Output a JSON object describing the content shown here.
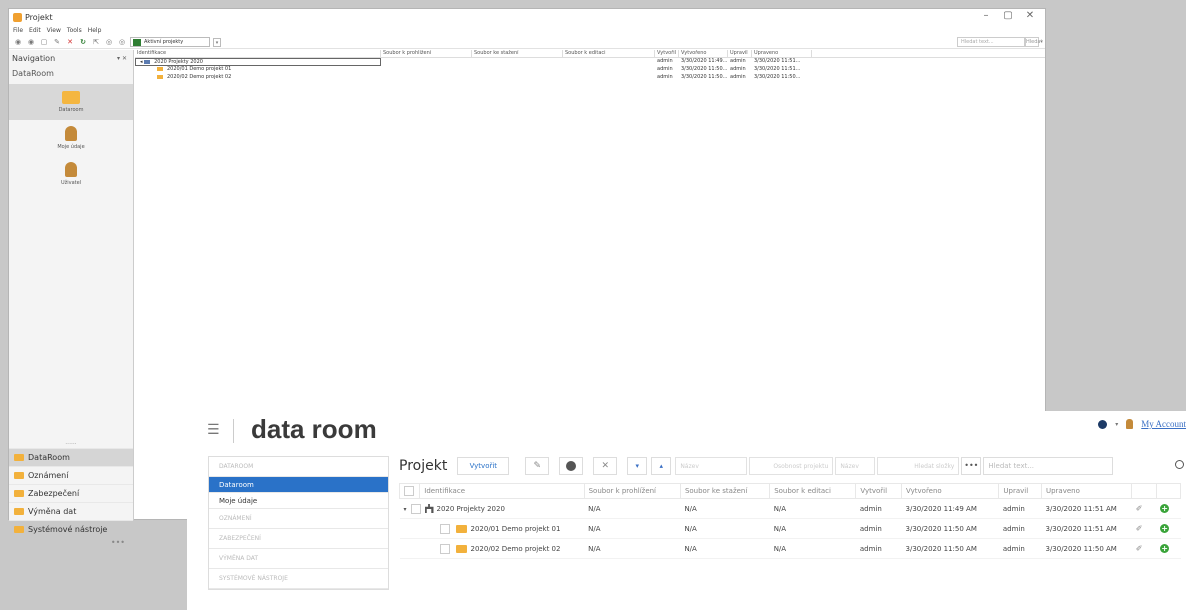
{
  "desktop": {
    "title": "Projekt",
    "window_controls": [
      "–",
      "▢",
      "✕"
    ],
    "menu": [
      "File",
      "Edit",
      "View",
      "Tools",
      "Help"
    ],
    "toolbar": {
      "filter_combo": "Aktivní projekty",
      "search_placeholder": "Hledat text...",
      "search_button": "Hledat"
    },
    "nav": {
      "header": "Navigation",
      "pin": "▾ ✕",
      "section": "DataRoom",
      "tiles": [
        "Dataroom",
        "Moje údaje",
        "Uživatel"
      ],
      "dots": "......",
      "bottom_items": [
        "DataRoom",
        "Oznámení",
        "Zabezpečení",
        "Výměna dat",
        "Systémové nástroje"
      ],
      "more": "•••"
    },
    "grid": {
      "columns": [
        "Identifikace",
        "Soubor k prohlížení",
        "Soubor ke stažení",
        "Soubor k editaci",
        "Vytvořil",
        "Vytvořeno",
        "Upravil",
        "Upraveno"
      ],
      "rows": [
        {
          "name": "2020 Projekty 2020",
          "created_by": "admin",
          "created": "3/30/2020 11:49...",
          "modified_by": "admin",
          "modified": "3/30/2020 11:51..."
        },
        {
          "name": "2020/01 Demo projekt 01",
          "created_by": "admin",
          "created": "3/30/2020 11:50...",
          "modified_by": "admin",
          "modified": "3/30/2020 11:51..."
        },
        {
          "name": "2020/02 Demo projekt 02",
          "created_by": "admin",
          "created": "3/30/2020 11:50...",
          "modified_by": "admin",
          "modified": "3/30/2020 11:50..."
        }
      ]
    }
  },
  "web": {
    "logo": "data room",
    "account": "My Account",
    "sidebar": {
      "section": "DATAROOM",
      "active": "Dataroom",
      "sub": "Moje údaje",
      "others": [
        "OZNÁMENÍ",
        "ZABEZPEČENÍ",
        "VÝMĚNA DAT",
        "SYSTÉMOVÉ NÁSTROJE"
      ]
    },
    "toolbar": {
      "title": "Projekt",
      "create": "Vytvořit",
      "field1": "Název",
      "field2": "Osobnost projektu",
      "field3": "Název",
      "field4": "Hledat složky",
      "more": "•••",
      "search_placeholder": "Hledat text..."
    },
    "table": {
      "columns": [
        "Identifikace",
        "Soubor k prohlížení",
        "Soubor ke stažení",
        "Soubor k editaci",
        "Vytvořil",
        "Vytvořeno",
        "Upravil",
        "Upraveno"
      ],
      "rows": [
        {
          "name": "2020 Projekty 2020",
          "view": "N/A",
          "download": "N/A",
          "edit": "N/A",
          "created_by": "admin",
          "created": "3/30/2020 11:49 AM",
          "modified_by": "admin",
          "modified": "3/30/2020 11:51 AM"
        },
        {
          "name": "2020/01 Demo projekt 01",
          "view": "N/A",
          "download": "N/A",
          "edit": "N/A",
          "created_by": "admin",
          "created": "3/30/2020 11:50 AM",
          "modified_by": "admin",
          "modified": "3/30/2020 11:51 AM"
        },
        {
          "name": "2020/02 Demo projekt 02",
          "view": "N/A",
          "download": "N/A",
          "edit": "N/A",
          "created_by": "admin",
          "created": "3/30/2020 11:50 AM",
          "modified_by": "admin",
          "modified": "3/30/2020 11:50 AM"
        }
      ]
    }
  }
}
